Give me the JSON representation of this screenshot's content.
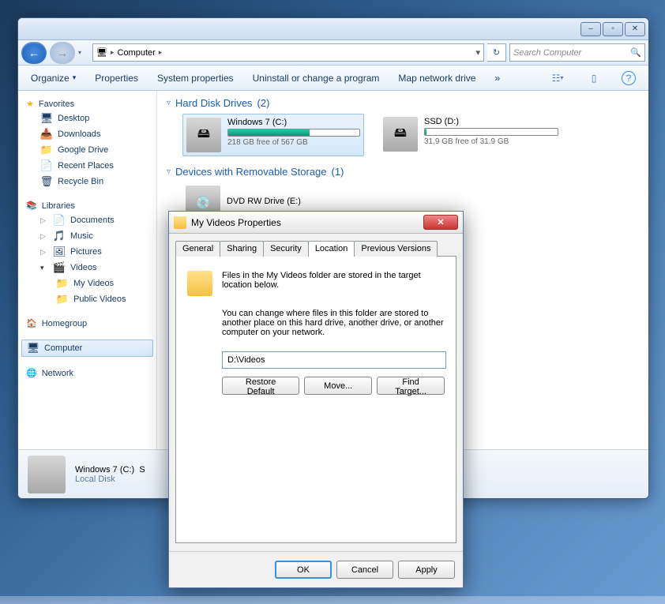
{
  "titlebar": {
    "minimize": "–",
    "maximize": "▫",
    "close": "✕"
  },
  "navbar": {
    "back_arrow": "←",
    "fwd_arrow": "→",
    "dropdown": "▾",
    "breadcrumb_root": "Computer",
    "crumb_arrow": "▸",
    "refresh": "↻",
    "search_placeholder": "Search Computer",
    "search_icon": "🔍"
  },
  "toolbar": {
    "organize": "Organize",
    "organize_arrow": "▾",
    "properties": "Properties",
    "system_properties": "System properties",
    "uninstall": "Uninstall or change a program",
    "map_drive": "Map network drive",
    "overflow": "»",
    "view_icon": "☷",
    "view_arrow": "▾",
    "preview_icon": "▯",
    "help_icon": "?"
  },
  "sidebar": {
    "favorites": "Favorites",
    "fav_items": [
      {
        "icon": "🖥",
        "label": "Desktop"
      },
      {
        "icon": "📥",
        "label": "Downloads"
      },
      {
        "icon": "📁",
        "label": "Google Drive"
      },
      {
        "icon": "📄",
        "label": "Recent Places"
      },
      {
        "icon": "🗑",
        "label": "Recycle Bin"
      }
    ],
    "libraries": "Libraries",
    "lib_items": [
      {
        "icon": "📄",
        "label": "Documents"
      },
      {
        "icon": "🎵",
        "label": "Music"
      },
      {
        "icon": "🖼",
        "label": "Pictures"
      },
      {
        "icon": "🎬",
        "label": "Videos"
      }
    ],
    "videos_children": [
      {
        "icon": "📁",
        "label": "My Videos"
      },
      {
        "icon": "📁",
        "label": "Public Videos"
      }
    ],
    "homegroup": "Homegroup",
    "homegroup_icon": "🏠",
    "computer": "Computer",
    "computer_icon": "🖥",
    "network": "Network",
    "network_icon": "🌐"
  },
  "content": {
    "section1_label": "Hard Disk Drives",
    "section1_count": "(2)",
    "drive_c": {
      "name": "Windows 7 (C:)",
      "free": "218 GB free of 567 GB",
      "fill_pct": 62
    },
    "drive_d": {
      "name": "SSD (D:)",
      "free": "31.9 GB free of 31.9 GB",
      "fill_pct": 1
    },
    "section2_label": "Devices with Removable Storage",
    "section2_count": "(1)",
    "dvd": {
      "name": "DVD RW Drive (E:)"
    }
  },
  "status": {
    "title": "Windows 7 (C:)",
    "sub": "Local Disk",
    "overflow": "S"
  },
  "props": {
    "title": "My Videos Properties",
    "close": "✕",
    "tabs": [
      "General",
      "Sharing",
      "Security",
      "Location",
      "Previous Versions"
    ],
    "active_tab": "Location",
    "intro": "Files in the My Videos folder are stored in the target location below.",
    "desc": "You can change where files in this folder are stored to another place on this hard drive, another drive, or another computer on your network.",
    "path_value": "D:\\Videos",
    "restore_btn": "Restore Default",
    "move_btn": "Move...",
    "find_btn": "Find Target...",
    "ok": "OK",
    "cancel": "Cancel",
    "apply": "Apply"
  }
}
